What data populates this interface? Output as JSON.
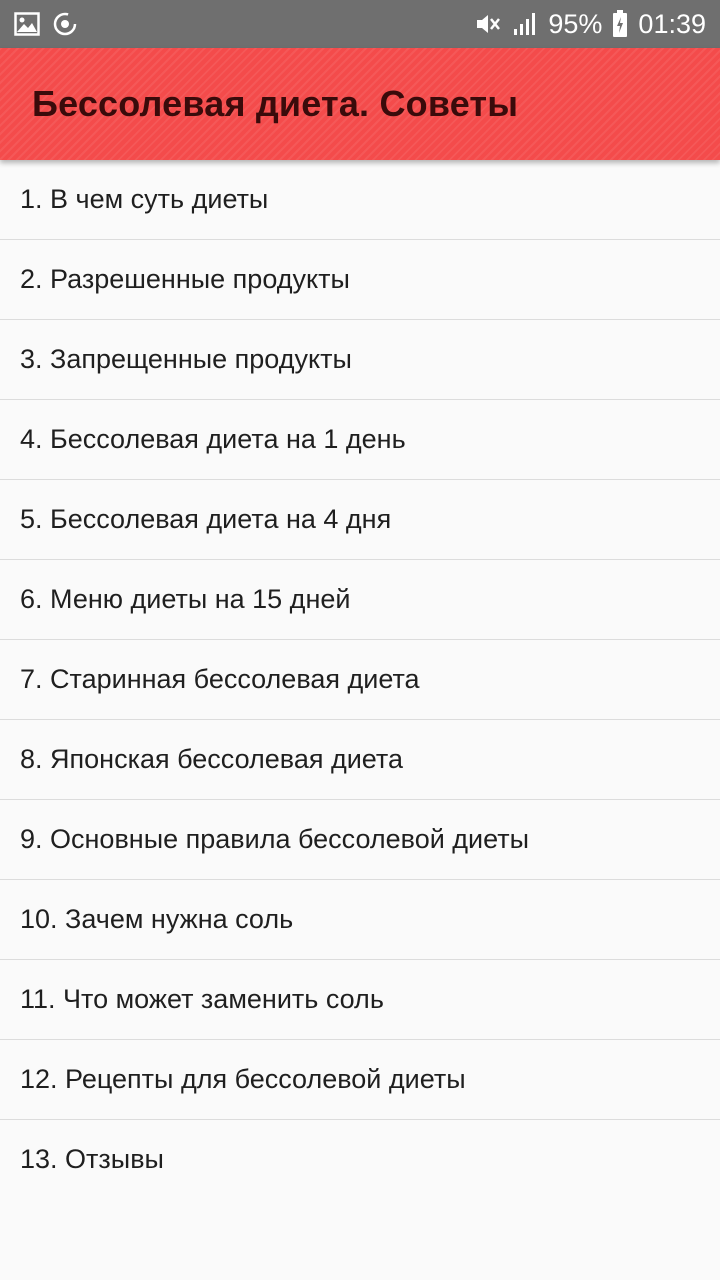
{
  "status_bar": {
    "battery": "95%",
    "time": "01:39",
    "icons": [
      "image-icon",
      "sync-icon",
      "mute-icon",
      "signal-icon",
      "battery-icon"
    ]
  },
  "app_bar": {
    "title": "Бессолевая диета. Советы",
    "color": "#f44b4b"
  },
  "list": {
    "items": [
      {
        "label": "1. В чем суть диеты"
      },
      {
        "label": "2. Разрешенные продукты"
      },
      {
        "label": "3. Запрещенные продукты"
      },
      {
        "label": "4. Бессолевая диета на 1 день"
      },
      {
        "label": "5. Бессолевая диета на 4 дня"
      },
      {
        "label": "6. Меню диеты на 15 дней"
      },
      {
        "label": "7. Старинная бессолевая диета"
      },
      {
        "label": "8. Японская бессолевая диета"
      },
      {
        "label": "9. Основные правила бессолевой диеты"
      },
      {
        "label": "10. Зачем нужна соль"
      },
      {
        "label": "11. Что может заменить соль"
      },
      {
        "label": "12. Рецепты для бессолевой диеты"
      },
      {
        "label": "13. Отзывы"
      }
    ]
  }
}
